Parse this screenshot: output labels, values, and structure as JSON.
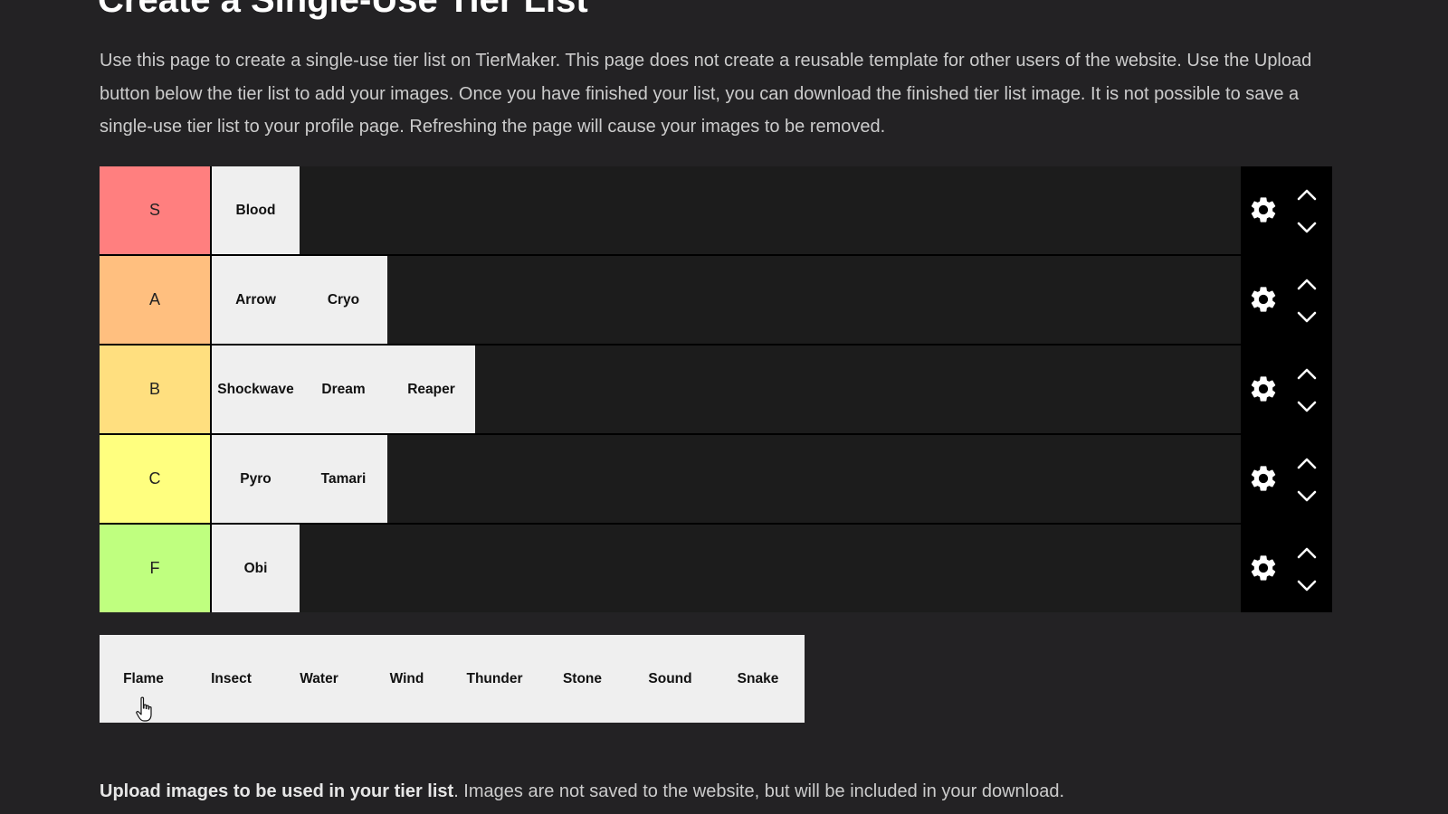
{
  "page": {
    "title": "Create a Single-Use Tier List",
    "intro": "Use this page to create a single-use tier list on TierMaker. This page does not create a reusable template for other users of the website. Use the Upload button below the tier list to add your images. Once you have finished your list, you can download the finished tier list image. It is not possible to save a single-use tier list to your profile page. Refreshing the page will cause your images to be removed.",
    "upload_bold": "Upload images to be used in your tier list",
    "upload_rest": ". Images are not saved to the website, but will be included in your download."
  },
  "tiers": [
    {
      "label": "S",
      "color": "#ff7f7f",
      "items": [
        "Blood"
      ]
    },
    {
      "label": "A",
      "color": "#ffbf7f",
      "items": [
        "Arrow",
        "Cryo"
      ]
    },
    {
      "label": "B",
      "color": "#ffdf7f",
      "items": [
        "Shockwave",
        "Dream",
        "Reaper"
      ]
    },
    {
      "label": "C",
      "color": "#ffff7f",
      "items": [
        "Pyro",
        "Tamari"
      ]
    },
    {
      "label": "F",
      "color": "#bfff7f",
      "items": [
        "Obi"
      ]
    }
  ],
  "pool": [
    "Flame",
    "Insect",
    "Water",
    "Wind",
    "Thunder",
    "Stone",
    "Sound",
    "Snake"
  ],
  "icons": {
    "settings": "gear-icon",
    "move_up": "chevron-up-icon",
    "move_down": "chevron-down-icon",
    "cursor": "hand-pointer-icon"
  }
}
